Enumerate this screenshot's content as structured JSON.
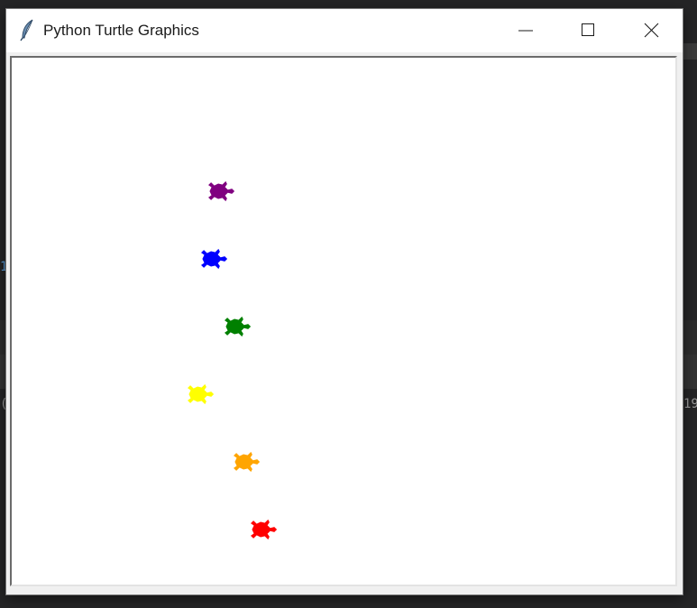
{
  "window": {
    "title": "Python Turtle Graphics",
    "icons": {
      "app": "feather-icon",
      "minimize": "minimize-icon",
      "maximize": "maximize-icon",
      "close": "close-icon"
    }
  },
  "background": {
    "fragment_left_1": "1",
    "fragment_left_2": "(",
    "fragment_right": "19"
  },
  "turtles": [
    {
      "color": "#800080",
      "name": "purple"
    },
    {
      "color": "#0000ff",
      "name": "blue"
    },
    {
      "color": "#008000",
      "name": "green"
    },
    {
      "color": "#ffff00",
      "name": "yellow"
    },
    {
      "color": "#ffa500",
      "name": "orange"
    },
    {
      "color": "#ff0000",
      "name": "red"
    }
  ]
}
